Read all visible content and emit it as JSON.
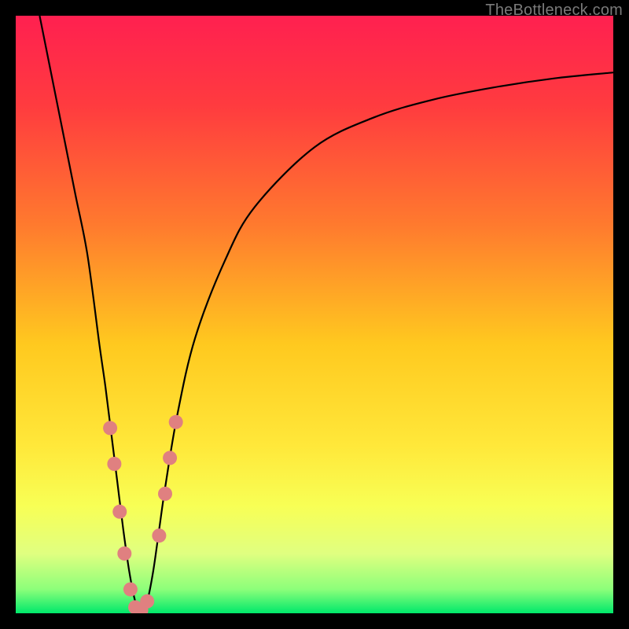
{
  "watermark": "TheBottleneck.com",
  "chart_data": {
    "type": "line",
    "title": "",
    "xlabel": "",
    "ylabel": "",
    "xlim": [
      0,
      100
    ],
    "ylim": [
      0,
      100
    ],
    "gradient_stops": [
      {
        "offset": 0.0,
        "color": "#ff2050"
      },
      {
        "offset": 0.15,
        "color": "#ff3b3f"
      },
      {
        "offset": 0.35,
        "color": "#ff7a2e"
      },
      {
        "offset": 0.55,
        "color": "#ffc91f"
      },
      {
        "offset": 0.72,
        "color": "#ffe83a"
      },
      {
        "offset": 0.82,
        "color": "#f8ff55"
      },
      {
        "offset": 0.9,
        "color": "#e0ff80"
      },
      {
        "offset": 0.96,
        "color": "#8cff7a"
      },
      {
        "offset": 1.0,
        "color": "#00e86b"
      }
    ],
    "series": [
      {
        "name": "bottleneck-curve",
        "color": "#000000",
        "x": [
          4,
          6,
          8,
          10,
          12,
          14,
          15,
          16,
          17,
          18,
          19,
          20,
          21,
          22,
          23,
          24,
          25,
          27,
          30,
          35,
          40,
          50,
          60,
          70,
          80,
          90,
          100
        ],
        "values": [
          100,
          90,
          80,
          70,
          60,
          45,
          38,
          30,
          22,
          14,
          7,
          2,
          0,
          2,
          7,
          14,
          21,
          33,
          46,
          59,
          68,
          78,
          83,
          86,
          88,
          89.5,
          90.5
        ]
      }
    ],
    "markers": {
      "name": "highlight-points",
      "color": "#e08080",
      "radius": 9,
      "points": [
        {
          "x": 15.8,
          "y": 31
        },
        {
          "x": 16.5,
          "y": 25
        },
        {
          "x": 17.4,
          "y": 17
        },
        {
          "x": 18.2,
          "y": 10
        },
        {
          "x": 19.2,
          "y": 4
        },
        {
          "x": 20.0,
          "y": 1
        },
        {
          "x": 21.0,
          "y": 0.5
        },
        {
          "x": 22.0,
          "y": 2
        },
        {
          "x": 24.0,
          "y": 13
        },
        {
          "x": 25.0,
          "y": 20
        },
        {
          "x": 25.8,
          "y": 26
        },
        {
          "x": 26.8,
          "y": 32
        }
      ]
    }
  }
}
